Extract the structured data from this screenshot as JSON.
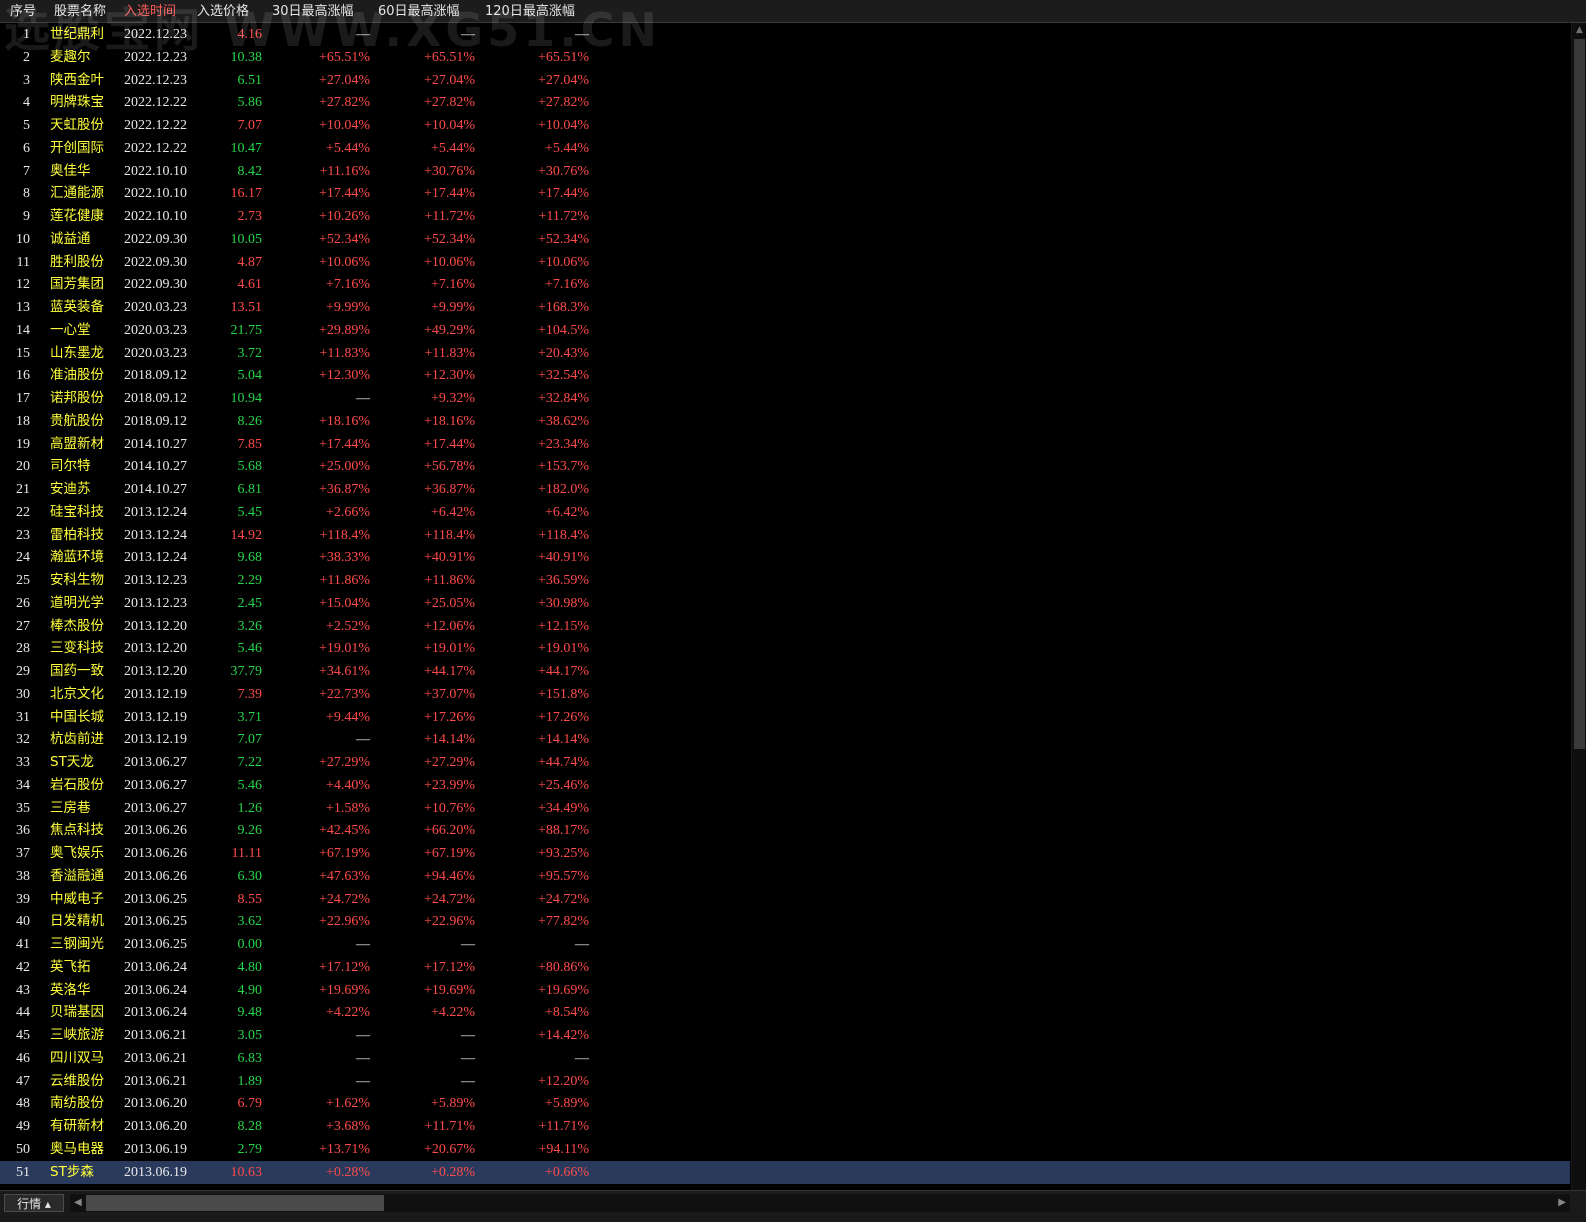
{
  "watermark": "选股宝网 WWW.XG51.CN",
  "header": {
    "columns": [
      "序号",
      "股票名称",
      "入选时间",
      "入选价格",
      "30日最高涨幅",
      "60日最高涨幅",
      "120日最高涨幅"
    ],
    "active_column": "入选时间"
  },
  "colors": {
    "up": "#ff4b4b",
    "down": "#27d64a",
    "name": "#ffff3c",
    "selected_row": "#2a3a5c"
  },
  "rows": [
    {
      "idx": "1",
      "name": "世纪鼎利",
      "date": "2022.12.23",
      "price": "4.16",
      "trend": "up",
      "g30": "—",
      "g60": "—",
      "g120": "—"
    },
    {
      "idx": "2",
      "name": "麦趣尔",
      "date": "2022.12.23",
      "price": "10.38",
      "trend": "down",
      "g30": "+65.51%",
      "g60": "+65.51%",
      "g120": "+65.51%"
    },
    {
      "idx": "3",
      "name": "陕西金叶",
      "date": "2022.12.23",
      "price": "6.51",
      "trend": "down",
      "g30": "+27.04%",
      "g60": "+27.04%",
      "g120": "+27.04%"
    },
    {
      "idx": "4",
      "name": "明牌珠宝",
      "date": "2022.12.22",
      "price": "5.86",
      "trend": "down",
      "g30": "+27.82%",
      "g60": "+27.82%",
      "g120": "+27.82%"
    },
    {
      "idx": "5",
      "name": "天虹股份",
      "date": "2022.12.22",
      "price": "7.07",
      "trend": "up",
      "g30": "+10.04%",
      "g60": "+10.04%",
      "g120": "+10.04%"
    },
    {
      "idx": "6",
      "name": "开创国际",
      "date": "2022.12.22",
      "price": "10.47",
      "trend": "down",
      "g30": "+5.44%",
      "g60": "+5.44%",
      "g120": "+5.44%"
    },
    {
      "idx": "7",
      "name": "奥佳华",
      "date": "2022.10.10",
      "price": "8.42",
      "trend": "down",
      "g30": "+11.16%",
      "g60": "+30.76%",
      "g120": "+30.76%"
    },
    {
      "idx": "8",
      "name": "汇通能源",
      "date": "2022.10.10",
      "price": "16.17",
      "trend": "up",
      "g30": "+17.44%",
      "g60": "+17.44%",
      "g120": "+17.44%"
    },
    {
      "idx": "9",
      "name": "莲花健康",
      "date": "2022.10.10",
      "price": "2.73",
      "trend": "up",
      "g30": "+10.26%",
      "g60": "+11.72%",
      "g120": "+11.72%"
    },
    {
      "idx": "10",
      "name": "诚益通",
      "date": "2022.09.30",
      "price": "10.05",
      "trend": "down",
      "g30": "+52.34%",
      "g60": "+52.34%",
      "g120": "+52.34%"
    },
    {
      "idx": "11",
      "name": "胜利股份",
      "date": "2022.09.30",
      "price": "4.87",
      "trend": "up",
      "g30": "+10.06%",
      "g60": "+10.06%",
      "g120": "+10.06%"
    },
    {
      "idx": "12",
      "name": "国芳集团",
      "date": "2022.09.30",
      "price": "4.61",
      "trend": "up",
      "g30": "+7.16%",
      "g60": "+7.16%",
      "g120": "+7.16%"
    },
    {
      "idx": "13",
      "name": "蓝英装备",
      "date": "2020.03.23",
      "price": "13.51",
      "trend": "up",
      "g30": "+9.99%",
      "g60": "+9.99%",
      "g120": "+168.3%"
    },
    {
      "idx": "14",
      "name": "一心堂",
      "date": "2020.03.23",
      "price": "21.75",
      "trend": "down",
      "g30": "+29.89%",
      "g60": "+49.29%",
      "g120": "+104.5%"
    },
    {
      "idx": "15",
      "name": "山东墨龙",
      "date": "2020.03.23",
      "price": "3.72",
      "trend": "down",
      "g30": "+11.83%",
      "g60": "+11.83%",
      "g120": "+20.43%"
    },
    {
      "idx": "16",
      "name": "准油股份",
      "date": "2018.09.12",
      "price": "5.04",
      "trend": "down",
      "g30": "+12.30%",
      "g60": "+12.30%",
      "g120": "+32.54%"
    },
    {
      "idx": "17",
      "name": "诺邦股份",
      "date": "2018.09.12",
      "price": "10.94",
      "trend": "down",
      "g30": "—",
      "g60": "+9.32%",
      "g120": "+32.84%"
    },
    {
      "idx": "18",
      "name": "贵航股份",
      "date": "2018.09.12",
      "price": "8.26",
      "trend": "down",
      "g30": "+18.16%",
      "g60": "+18.16%",
      "g120": "+38.62%"
    },
    {
      "idx": "19",
      "name": "高盟新材",
      "date": "2014.10.27",
      "price": "7.85",
      "trend": "up",
      "g30": "+17.44%",
      "g60": "+17.44%",
      "g120": "+23.34%"
    },
    {
      "idx": "20",
      "name": "司尔特",
      "date": "2014.10.27",
      "price": "5.68",
      "trend": "down",
      "g30": "+25.00%",
      "g60": "+56.78%",
      "g120": "+153.7%"
    },
    {
      "idx": "21",
      "name": "安迪苏",
      "date": "2014.10.27",
      "price": "6.81",
      "trend": "down",
      "g30": "+36.87%",
      "g60": "+36.87%",
      "g120": "+182.0%"
    },
    {
      "idx": "22",
      "name": "硅宝科技",
      "date": "2013.12.24",
      "price": "5.45",
      "trend": "down",
      "g30": "+2.66%",
      "g60": "+6.42%",
      "g120": "+6.42%"
    },
    {
      "idx": "23",
      "name": "雷柏科技",
      "date": "2013.12.24",
      "price": "14.92",
      "trend": "up",
      "g30": "+118.4%",
      "g60": "+118.4%",
      "g120": "+118.4%"
    },
    {
      "idx": "24",
      "name": "瀚蓝环境",
      "date": "2013.12.24",
      "price": "9.68",
      "trend": "down",
      "g30": "+38.33%",
      "g60": "+40.91%",
      "g120": "+40.91%"
    },
    {
      "idx": "25",
      "name": "安科生物",
      "date": "2013.12.23",
      "price": "2.29",
      "trend": "down",
      "g30": "+11.86%",
      "g60": "+11.86%",
      "g120": "+36.59%"
    },
    {
      "idx": "26",
      "name": "道明光学",
      "date": "2013.12.23",
      "price": "2.45",
      "trend": "down",
      "g30": "+15.04%",
      "g60": "+25.05%",
      "g120": "+30.98%"
    },
    {
      "idx": "27",
      "name": "棒杰股份",
      "date": "2013.12.20",
      "price": "3.26",
      "trend": "down",
      "g30": "+2.52%",
      "g60": "+12.06%",
      "g120": "+12.15%"
    },
    {
      "idx": "28",
      "name": "三变科技",
      "date": "2013.12.20",
      "price": "5.46",
      "trend": "down",
      "g30": "+19.01%",
      "g60": "+19.01%",
      "g120": "+19.01%"
    },
    {
      "idx": "29",
      "name": "国药一致",
      "date": "2013.12.20",
      "price": "37.79",
      "trend": "down",
      "g30": "+34.61%",
      "g60": "+44.17%",
      "g120": "+44.17%"
    },
    {
      "idx": "30",
      "name": "北京文化",
      "date": "2013.12.19",
      "price": "7.39",
      "trend": "up",
      "g30": "+22.73%",
      "g60": "+37.07%",
      "g120": "+151.8%"
    },
    {
      "idx": "31",
      "name": "中国长城",
      "date": "2013.12.19",
      "price": "3.71",
      "trend": "down",
      "g30": "+9.44%",
      "g60": "+17.26%",
      "g120": "+17.26%"
    },
    {
      "idx": "32",
      "name": "杭齿前进",
      "date": "2013.12.19",
      "price": "7.07",
      "trend": "down",
      "g30": "—",
      "g60": "+14.14%",
      "g120": "+14.14%"
    },
    {
      "idx": "33",
      "name": "ST天龙",
      "date": "2013.06.27",
      "price": "7.22",
      "trend": "down",
      "g30": "+27.29%",
      "g60": "+27.29%",
      "g120": "+44.74%"
    },
    {
      "idx": "34",
      "name": "岩石股份",
      "date": "2013.06.27",
      "price": "5.46",
      "trend": "down",
      "g30": "+4.40%",
      "g60": "+23.99%",
      "g120": "+25.46%"
    },
    {
      "idx": "35",
      "name": "三房巷",
      "date": "2013.06.27",
      "price": "1.26",
      "trend": "down",
      "g30": "+1.58%",
      "g60": "+10.76%",
      "g120": "+34.49%"
    },
    {
      "idx": "36",
      "name": "焦点科技",
      "date": "2013.06.26",
      "price": "9.26",
      "trend": "down",
      "g30": "+42.45%",
      "g60": "+66.20%",
      "g120": "+88.17%"
    },
    {
      "idx": "37",
      "name": "奥飞娱乐",
      "date": "2013.06.26",
      "price": "11.11",
      "trend": "up",
      "g30": "+67.19%",
      "g60": "+67.19%",
      "g120": "+93.25%"
    },
    {
      "idx": "38",
      "name": "香溢融通",
      "date": "2013.06.26",
      "price": "6.30",
      "trend": "down",
      "g30": "+47.63%",
      "g60": "+94.46%",
      "g120": "+95.57%"
    },
    {
      "idx": "39",
      "name": "中威电子",
      "date": "2013.06.25",
      "price": "8.55",
      "trend": "up",
      "g30": "+24.72%",
      "g60": "+24.72%",
      "g120": "+24.72%"
    },
    {
      "idx": "40",
      "name": "日发精机",
      "date": "2013.06.25",
      "price": "3.62",
      "trend": "down",
      "g30": "+22.96%",
      "g60": "+22.96%",
      "g120": "+77.82%"
    },
    {
      "idx": "41",
      "name": "三钢闽光",
      "date": "2013.06.25",
      "price": "0.00",
      "trend": "down",
      "g30": "—",
      "g60": "—",
      "g120": "—"
    },
    {
      "idx": "42",
      "name": "英飞拓",
      "date": "2013.06.24",
      "price": "4.80",
      "trend": "down",
      "g30": "+17.12%",
      "g60": "+17.12%",
      "g120": "+80.86%"
    },
    {
      "idx": "43",
      "name": "英洛华",
      "date": "2013.06.24",
      "price": "4.90",
      "trend": "down",
      "g30": "+19.69%",
      "g60": "+19.69%",
      "g120": "+19.69%"
    },
    {
      "idx": "44",
      "name": "贝瑞基因",
      "date": "2013.06.24",
      "price": "9.48",
      "trend": "down",
      "g30": "+4.22%",
      "g60": "+4.22%",
      "g120": "+8.54%"
    },
    {
      "idx": "45",
      "name": "三峡旅游",
      "date": "2013.06.21",
      "price": "3.05",
      "trend": "down",
      "g30": "—",
      "g60": "—",
      "g120": "+14.42%"
    },
    {
      "idx": "46",
      "name": "四川双马",
      "date": "2013.06.21",
      "price": "6.83",
      "trend": "down",
      "g30": "—",
      "g60": "—",
      "g120": "—"
    },
    {
      "idx": "47",
      "name": "云维股份",
      "date": "2013.06.21",
      "price": "1.89",
      "trend": "down",
      "g30": "—",
      "g60": "—",
      "g120": "+12.20%"
    },
    {
      "idx": "48",
      "name": "南纺股份",
      "date": "2013.06.20",
      "price": "6.79",
      "trend": "up",
      "g30": "+1.62%",
      "g60": "+5.89%",
      "g120": "+5.89%"
    },
    {
      "idx": "49",
      "name": "有研新材",
      "date": "2013.06.20",
      "price": "8.28",
      "trend": "down",
      "g30": "+3.68%",
      "g60": "+11.71%",
      "g120": "+11.71%"
    },
    {
      "idx": "50",
      "name": "奥马电器",
      "date": "2013.06.19",
      "price": "2.79",
      "trend": "down",
      "g30": "+13.71%",
      "g60": "+20.67%",
      "g120": "+94.11%"
    },
    {
      "idx": "51",
      "name": "ST步森",
      "date": "2013.06.19",
      "price": "10.63",
      "trend": "up",
      "g30": "+0.28%",
      "g60": "+0.28%",
      "g120": "+0.66%",
      "selected": true
    }
  ],
  "footer": {
    "tab_label": "行情 ▴"
  }
}
